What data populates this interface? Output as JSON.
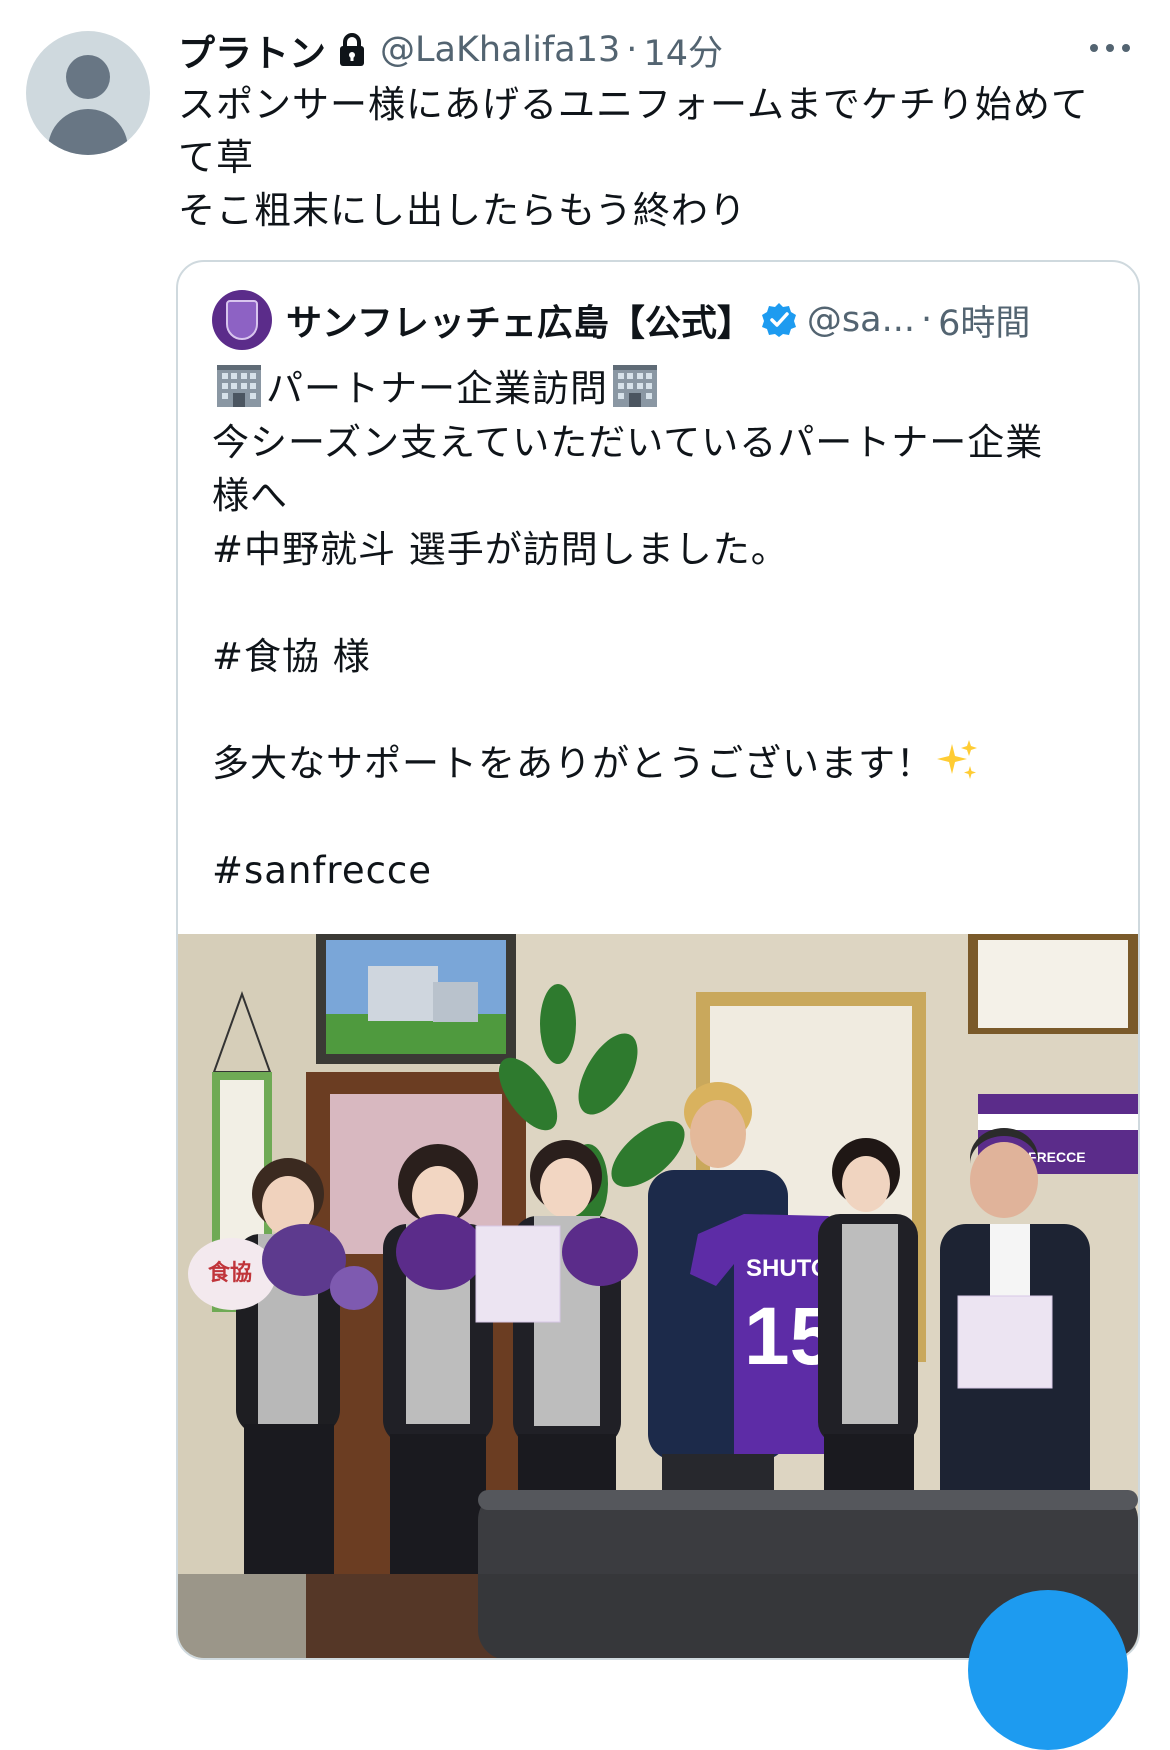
{
  "tweet": {
    "display_name": "プラトン",
    "handle": "@LaKhalifa13",
    "separator": "·",
    "time": "14分",
    "text": "スポンサー様にあげるユニフォームまでケチり始めて\nて草\nそこ粗末にし出したらもう終わり",
    "icons": [
      "avatar-placeholder",
      "lock-icon",
      "more-icon"
    ]
  },
  "quoted": {
    "display_name": "サンフレッチェ広島【公式】",
    "handle": "@sa...",
    "separator": "·",
    "time": "6時間",
    "lines": {
      "l1": "パートナー企業訪問",
      "l2": "今シーズン支えていただいているパートナー企業\n様へ\n#中野就斗 選手が訪問しました。\n\n#食協 様\n\n多大なサポートをありがとうございます！",
      "l3": "\n\n#sanfrecce"
    },
    "icons": [
      "verified-badge-icon",
      "office-building-emoji",
      "sparkles-emoji"
    ],
    "verified_color": "#1d9bf0",
    "photo": {
      "jersey_name": "SHUTO",
      "jersey_number": "15",
      "fan_label": "食協",
      "banner_label": "FRECCE"
    }
  },
  "colors": {
    "accent": "#1d9bf0",
    "secondary_text": "#536471",
    "club_purple": "#5b2c8a"
  }
}
